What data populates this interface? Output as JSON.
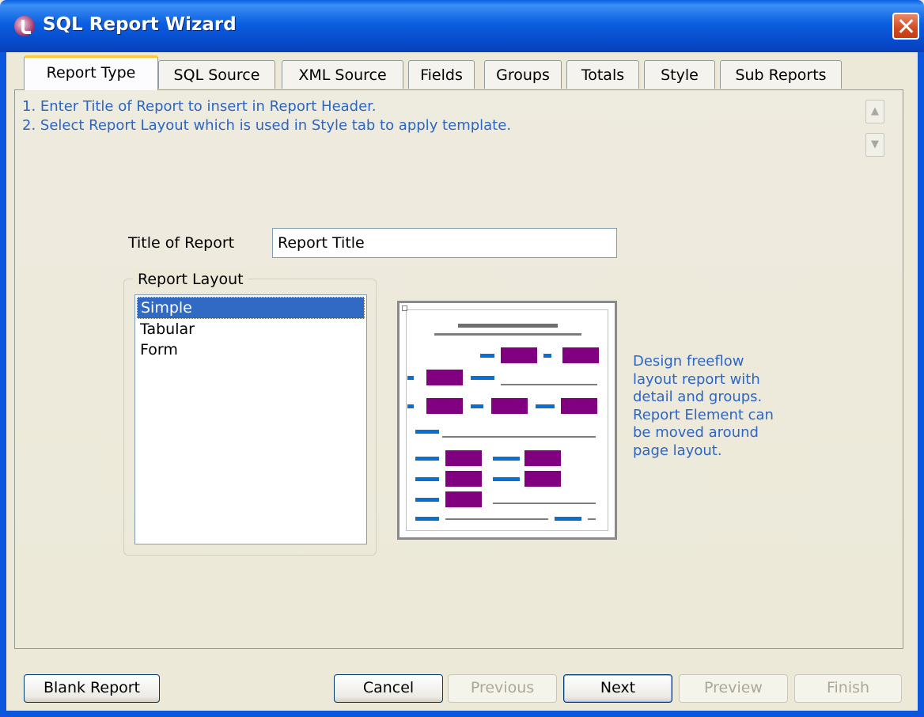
{
  "window": {
    "title": "SQL Report Wizard"
  },
  "tabs": [
    {
      "label": "Report Type"
    },
    {
      "label": "SQL Source"
    },
    {
      "label": "XML Source"
    },
    {
      "label": "Fields"
    },
    {
      "label": "Groups"
    },
    {
      "label": "Totals"
    },
    {
      "label": "Style"
    },
    {
      "label": "Sub Reports"
    }
  ],
  "instructions": {
    "line1": "1. Enter Title of Report to insert in Report Header.",
    "line2": "2. Select Report Layout which is used in Style tab to apply template."
  },
  "scroll": {
    "up_icon": "chevron-up-icon",
    "down_icon": "chevron-down-icon"
  },
  "title_field": {
    "label": "Title of Report",
    "value": "Report Title"
  },
  "layout": {
    "legend": "Report Layout",
    "options": [
      "Simple",
      "Tabular",
      "Form"
    ],
    "selected": "Simple"
  },
  "description": "Design freeflow\nlayout report with\ndetail and groups.\nReport Element can\nbe moved around\npage layout.",
  "buttons": {
    "blank": "Blank Report",
    "cancel": "Cancel",
    "previous": "Previous",
    "next": "Next",
    "preview": "Preview",
    "finish": "Finish"
  },
  "colors": {
    "titlebar": "#0a5ee3",
    "accent_text": "#2c66c5",
    "selection": "#316ac5",
    "preview_block": "#800080",
    "preview_dash": "#0b6fd0",
    "active_tab_top": "#ffc83c"
  }
}
